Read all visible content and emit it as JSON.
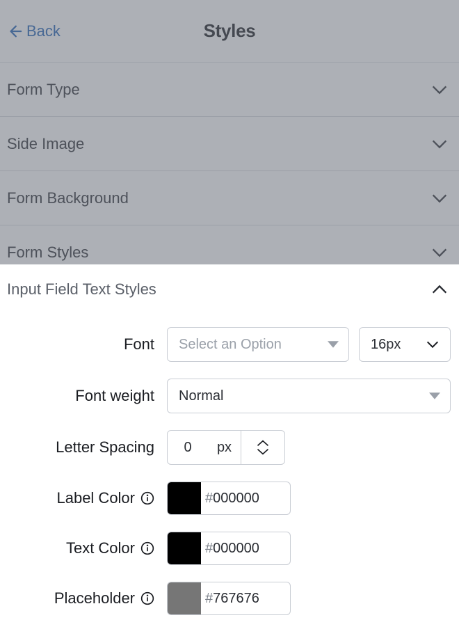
{
  "header": {
    "back_label": "Back",
    "title": "Styles"
  },
  "accordion": {
    "form_type": "Form Type",
    "side_image": "Side Image",
    "form_background": "Form Background",
    "form_styles": "Form Styles",
    "input_field_text_styles": "Input Field Text Styles"
  },
  "fields": {
    "font": {
      "label": "Font",
      "placeholder": "Select an Option",
      "size_value": "16px"
    },
    "font_weight": {
      "label": "Font weight",
      "value": "Normal"
    },
    "letter_spacing": {
      "label": "Letter Spacing",
      "value": "0",
      "unit": "px"
    },
    "label_color": {
      "label": "Label Color",
      "hex": "000000",
      "swatch": "#000000"
    },
    "text_color": {
      "label": "Text Color",
      "hex": "000000",
      "swatch": "#000000"
    },
    "placeholder_color": {
      "label": "Placeholder",
      "hex": "767676",
      "swatch": "#767676"
    }
  }
}
